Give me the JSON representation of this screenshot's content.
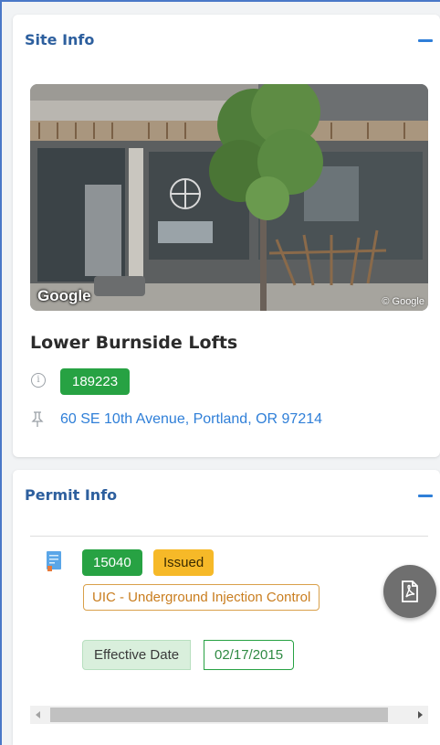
{
  "site_info": {
    "title": "Site Info",
    "collapse_icon": "minus-icon",
    "photo": {
      "watermark_logo": "Google",
      "copyright": "© Google"
    },
    "site_name": "Lower Burnside Lofts",
    "info_icon": "info-circle-icon",
    "site_id": "189223",
    "pin_icon": "pushpin-icon",
    "address": "60 SE 10th Avenue, Portland, OR 97214"
  },
  "permit_info": {
    "title": "Permit Info",
    "collapse_icon": "minus-icon",
    "doc_icon": "document-icon",
    "permit_number": "15040",
    "status": "Issued",
    "permit_type": "UIC - Underground Injection Control",
    "effective_date_label": "Effective Date",
    "effective_date": "02/17/2015",
    "pdf_icon": "pdf-file-icon"
  },
  "colors": {
    "heading": "#2d5f9e",
    "link": "#2f7fd8",
    "badge_green": "#27a243",
    "badge_amber": "#f6b928",
    "tag_orange": "#c97d1e"
  }
}
